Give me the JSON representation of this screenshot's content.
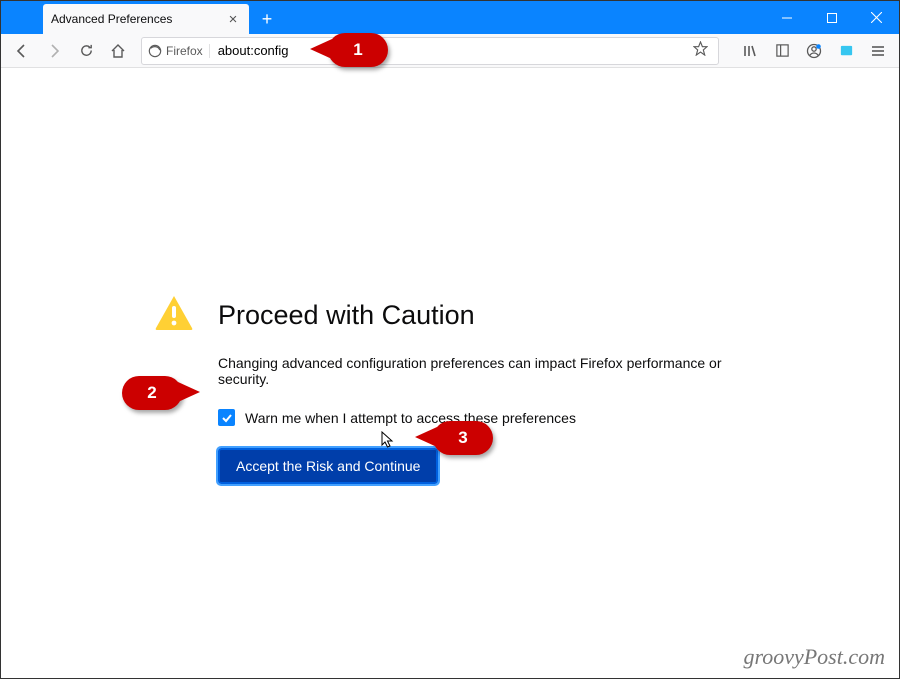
{
  "tab": {
    "title": "Advanced Preferences"
  },
  "urlbar": {
    "identity_label": "Firefox",
    "url": "about:config"
  },
  "page": {
    "heading": "Proceed with Caution",
    "description": "Changing advanced configuration preferences can impact Firefox performance or security.",
    "checkbox_label": "Warn me when I attempt to access these preferences",
    "checkbox_checked": true,
    "accept_button": "Accept the Risk and Continue"
  },
  "callouts": {
    "c1": "1",
    "c2": "2",
    "c3": "3"
  },
  "watermark": "groovyPost.com"
}
